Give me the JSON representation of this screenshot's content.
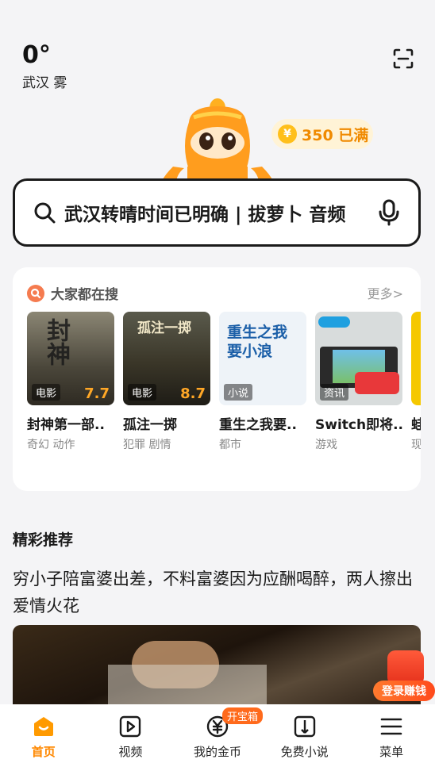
{
  "weather": {
    "temp": "0°",
    "city": "武汉 雾"
  },
  "coins": {
    "icon": "yen-coin-icon",
    "text": "350 已满"
  },
  "search": {
    "query": "武汉转晴时间已明确 | 拔萝卜 音频"
  },
  "hot": {
    "title": "大家都在搜",
    "more": "更多>",
    "items": [
      {
        "tag": "电影",
        "score": "7.7",
        "name": "封神第一部..",
        "sub": "奇幻 动作",
        "poster_text": "封神",
        "bg": "#5a5648"
      },
      {
        "tag": "电影",
        "score": "8.7",
        "name": "孤注一掷",
        "sub": "犯罪 剧情",
        "poster_text": "孤注一掷",
        "bg": "#3c3a32"
      },
      {
        "tag": "小说",
        "score": "",
        "name": "重生之我要..",
        "sub": "都市",
        "poster_text": "重生之我要小浪",
        "bg": "#eef3f8"
      },
      {
        "tag": "资讯",
        "score": "",
        "name": "Switch即将..",
        "sub": "游戏",
        "poster_text": "",
        "bg": "#cfd6d8"
      },
      {
        "tag": "",
        "score": "",
        "name": "蛙",
        "sub": "现",
        "poster_text": "",
        "bg": "#f5c800"
      }
    ]
  },
  "feed": {
    "section_title": "精彩推荐",
    "article_title": "穷小子陪富婆出差，不料富婆因为应酬喝醉，两人擦出爱情火花"
  },
  "floating": {
    "label": "登录赚钱"
  },
  "nav": {
    "items": [
      {
        "label": "首页",
        "icon": "home-icon",
        "active": true
      },
      {
        "label": "视频",
        "icon": "video-icon"
      },
      {
        "label": "我的金币",
        "icon": "coin-icon",
        "badge": "开宝箱"
      },
      {
        "label": "免费小说",
        "icon": "book-icon"
      },
      {
        "label": "菜单",
        "icon": "menu-icon"
      }
    ]
  },
  "colors": {
    "accent": "#ff8800",
    "coin": "#f08a00",
    "hot": "#f57b4f"
  }
}
